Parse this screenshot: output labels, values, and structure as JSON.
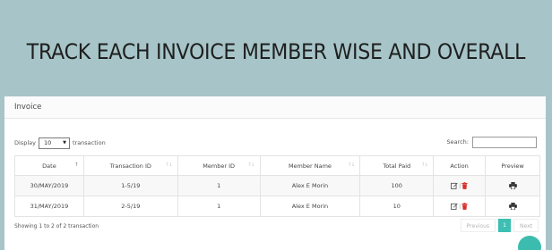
{
  "headline": "TRACK EACH INVOICE MEMBER WISE AND OVERALL",
  "panel": {
    "title": "Invoice"
  },
  "controls": {
    "display_label": "Display",
    "page_size": "10",
    "transaction_label": "transaction",
    "search_label": "Search:",
    "search_value": ""
  },
  "table": {
    "columns": [
      "Date",
      "Transaction ID",
      "Member ID",
      "Member Name",
      "Total Paid",
      "Action",
      "Preview"
    ],
    "rows": [
      [
        "30/MAY/2019",
        "1-5/19",
        "1",
        "Alex E Morin",
        "100"
      ],
      [
        "31/MAY/2019",
        "2-5/19",
        "1",
        "Alex E Morin",
        "10"
      ]
    ],
    "action_separator": "|"
  },
  "footer": {
    "info": "Showing 1 to 2 of 2 transaction",
    "previous": "Previous",
    "current_page": "1",
    "next": "Next"
  },
  "colors": {
    "background": "#a7c5c8",
    "accent": "#3dbfb2",
    "delete": "#d9302c"
  },
  "icons": [
    "caret-down-icon",
    "sort-icon",
    "edit-icon",
    "delete-icon",
    "print-icon",
    "chat-bubble-icon"
  ]
}
